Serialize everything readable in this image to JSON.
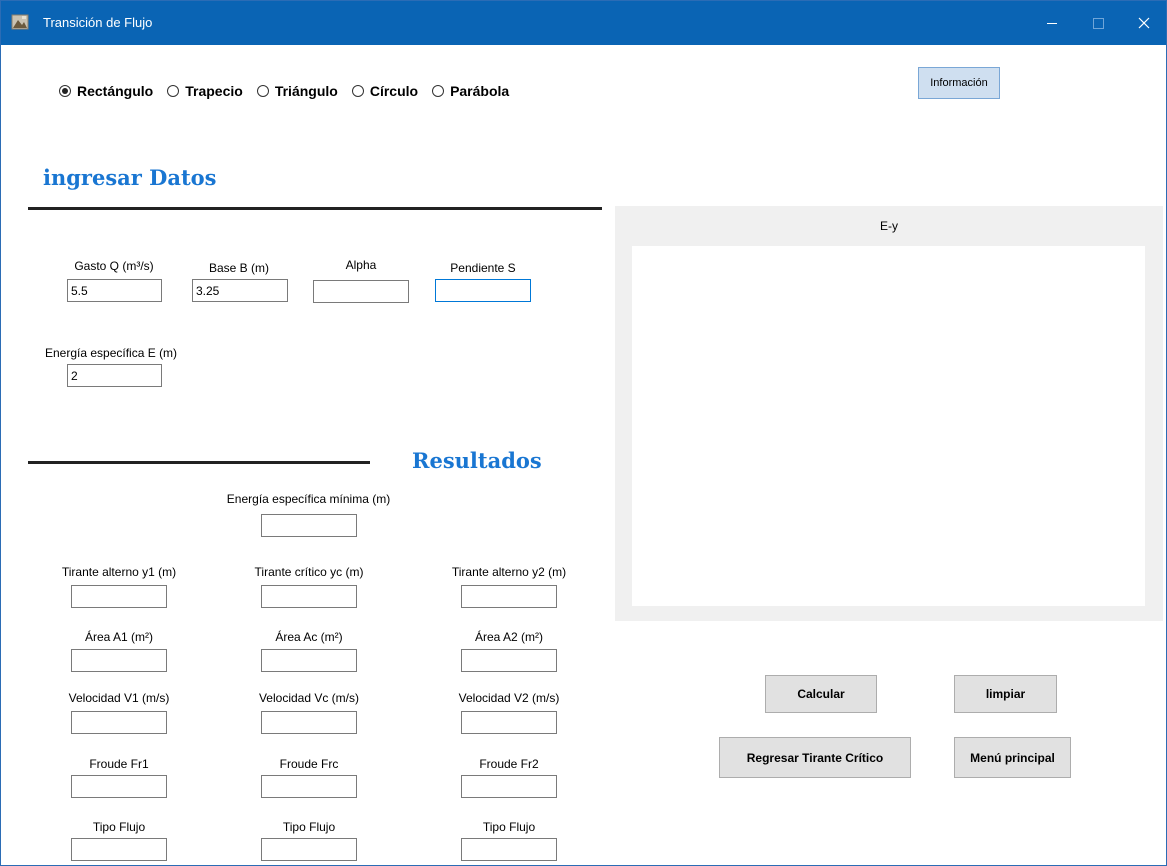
{
  "window": {
    "title": "Transición de Flujo"
  },
  "shapes": {
    "options": [
      {
        "label": "Rectángulo",
        "checked": true
      },
      {
        "label": "Trapecio",
        "checked": false
      },
      {
        "label": "Triángulo",
        "checked": false
      },
      {
        "label": "Círculo",
        "checked": false
      },
      {
        "label": "Parábola",
        "checked": false
      }
    ]
  },
  "toolbar": {
    "info_label": "Información"
  },
  "input_section": {
    "title": "ingresar Datos",
    "gasto": {
      "label": "Gasto Q (m³/s)",
      "value": "5.5"
    },
    "base": {
      "label": "Base B (m)",
      "value": "3.25"
    },
    "alpha": {
      "label": "Alpha",
      "value": ""
    },
    "pendiente": {
      "label": "Pendiente S",
      "value": ""
    },
    "energia": {
      "label": "Energía específica E (m)",
      "value": "2"
    }
  },
  "results_section": {
    "title": "Resultados",
    "energia_min": {
      "label": "Energía específica mínima (m)",
      "value": ""
    },
    "tirante_y1": {
      "label": "Tirante alterno y1 (m)",
      "value": ""
    },
    "tirante_yc": {
      "label": "Tirante crítico yc (m)",
      "value": ""
    },
    "tirante_y2": {
      "label": "Tirante alterno y2 (m)",
      "value": ""
    },
    "area_a1": {
      "label": "Área A1 (m²)",
      "value": ""
    },
    "area_ac": {
      "label": "Área Ac (m²)",
      "value": ""
    },
    "area_a2": {
      "label": "Área A2 (m²)",
      "value": ""
    },
    "vel_v1": {
      "label": "Velocidad V1 (m/s)",
      "value": ""
    },
    "vel_vc": {
      "label": "Velocidad Vc (m/s)",
      "value": ""
    },
    "vel_v2": {
      "label": "Velocidad V2 (m/s)",
      "value": ""
    },
    "froude_fr1": {
      "label": "Froude Fr1",
      "value": ""
    },
    "froude_frc": {
      "label": "Froude Frc",
      "value": ""
    },
    "froude_fr2": {
      "label": "Froude Fr2",
      "value": ""
    },
    "tipo_1": {
      "label": "Tipo Flujo",
      "value": ""
    },
    "tipo_c": {
      "label": "Tipo Flujo",
      "value": ""
    },
    "tipo_2": {
      "label": "Tipo Flujo",
      "value": ""
    }
  },
  "chart": {
    "title": "E-y"
  },
  "actions": {
    "calcular": "Calcular",
    "limpiar": "limpiar",
    "regresar": "Regresar Tirante Crítico",
    "menu": "Menú principal"
  },
  "colors": {
    "titlebar": "#0a64b4",
    "section_title": "#1976d2",
    "button_face": "#e1e1e1",
    "info_button": "#cfdff0"
  }
}
